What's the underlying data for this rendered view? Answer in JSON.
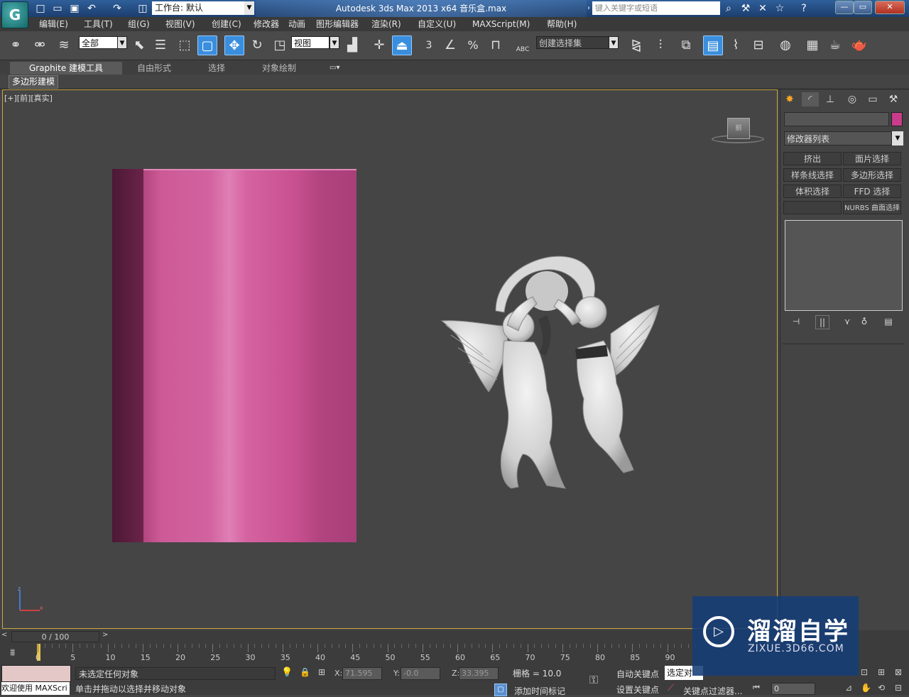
{
  "title_bar": {
    "logo": "G",
    "workspace": "工作台: 默认",
    "title": "Autodesk 3ds Max  2013 x64      音乐盒.max",
    "search_placeholder": "键入关键字或短语",
    "icons": [
      "new-icon",
      "open-icon",
      "save-icon",
      "undo-icon",
      "redo-icon",
      "project-icon",
      "binoculars-icon",
      "tools-icon",
      "exchange-icon",
      "star-icon",
      "help-icon"
    ]
  },
  "menu": [
    "编辑(E)",
    "工具(T)",
    "组(G)",
    "视图(V)",
    "创建(C)",
    "修改器",
    "动画",
    "图形编辑器",
    "渲染(R)",
    "自定义(U)",
    "MAXScript(M)",
    "帮助(H)"
  ],
  "toolbar": {
    "filter": "全部",
    "ref_coord": "视图",
    "named_selection": "创建选择集",
    "snap_3": "3",
    "percent": "%",
    "abc": "ABC"
  },
  "ribbon": {
    "tabs": [
      "Graphite 建模工具",
      "自由形式",
      "选择",
      "对象绘制"
    ],
    "sub_tab": "多边形建模"
  },
  "viewport": {
    "label": "[+][前][真实]",
    "viewcube": "前",
    "axis_z": "z",
    "axis_x": "x"
  },
  "command_panel": {
    "modifier_list": "修改器列表",
    "object_color": "#c93c8a",
    "buttons": [
      "挤出",
      "面片选择",
      "样条线选择",
      "多边形选择",
      "体积选择",
      "FFD 选择",
      "",
      "NURBS 曲面选择"
    ]
  },
  "timeline": {
    "frame": "0 / 100",
    "ticks": [
      "0",
      "5",
      "10",
      "15",
      "20",
      "25",
      "30",
      "35",
      "40",
      "45",
      "50",
      "55",
      "60",
      "65",
      "70",
      "75",
      "80",
      "85",
      "90"
    ]
  },
  "status": {
    "welcome": "欢迎使用 MAXScri",
    "selection": "未选定任何对象",
    "hint": "单击并拖动以选择并移动对象",
    "x": "71.595",
    "y": "-0.0",
    "z": "33.395",
    "grid": "栅格 = 10.0",
    "auto_key": "自动关键点",
    "set_key": "设置关键点",
    "selected": "选定对",
    "add_time_tag": "添加时间标记",
    "key_filters": "关键点过滤器...",
    "frame": "0"
  },
  "watermark": {
    "title": "溜溜自学",
    "url": "ZIXUE.3D66.COM"
  }
}
